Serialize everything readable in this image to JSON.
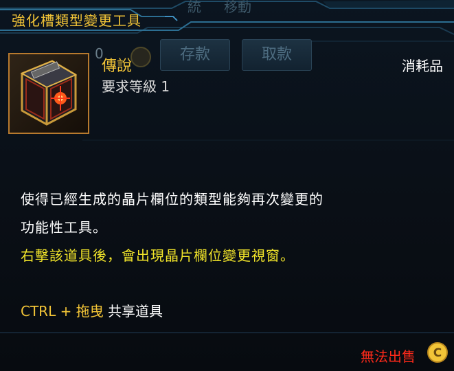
{
  "window_bg": {
    "btn_deposit": "存款",
    "btn_withdraw": "取款",
    "top_sys": "統",
    "top_move": "移動",
    "amount": "0"
  },
  "item": {
    "title": "強化槽類型變更工具",
    "rarity": "傳說",
    "required_level": "要求等級 1",
    "type": "消耗品",
    "icon": "cube-box-icon"
  },
  "description": {
    "line1": "使得已經生成的晶片欄位的類型能夠再次變更的",
    "line2": "功能性工具。",
    "line3": "右擊該道具後，會出現晶片欄位變更視窗。"
  },
  "share_hint": {
    "key": "CTRL + 拖曳",
    "text": "共享道具"
  },
  "footer": {
    "cannot_sell": "無法出售",
    "coin_icon": "coin-c-icon"
  },
  "colors": {
    "gold": "#f2c437",
    "yellow": "#f2e52a",
    "red": "#ff2a1a",
    "bg": "#0a0f16"
  }
}
